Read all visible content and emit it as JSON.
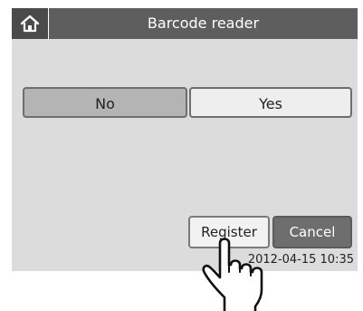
{
  "header": {
    "title": "Barcode reader",
    "home_icon": "home-icon"
  },
  "dialog": {
    "no_label": "No",
    "yes_label": "Yes"
  },
  "footer": {
    "register_label": "Register",
    "cancel_label": "Cancel",
    "timestamp": "2012-04-15 10:35"
  },
  "overlay": {
    "pointer_icon": "pointing-hand-icon"
  }
}
